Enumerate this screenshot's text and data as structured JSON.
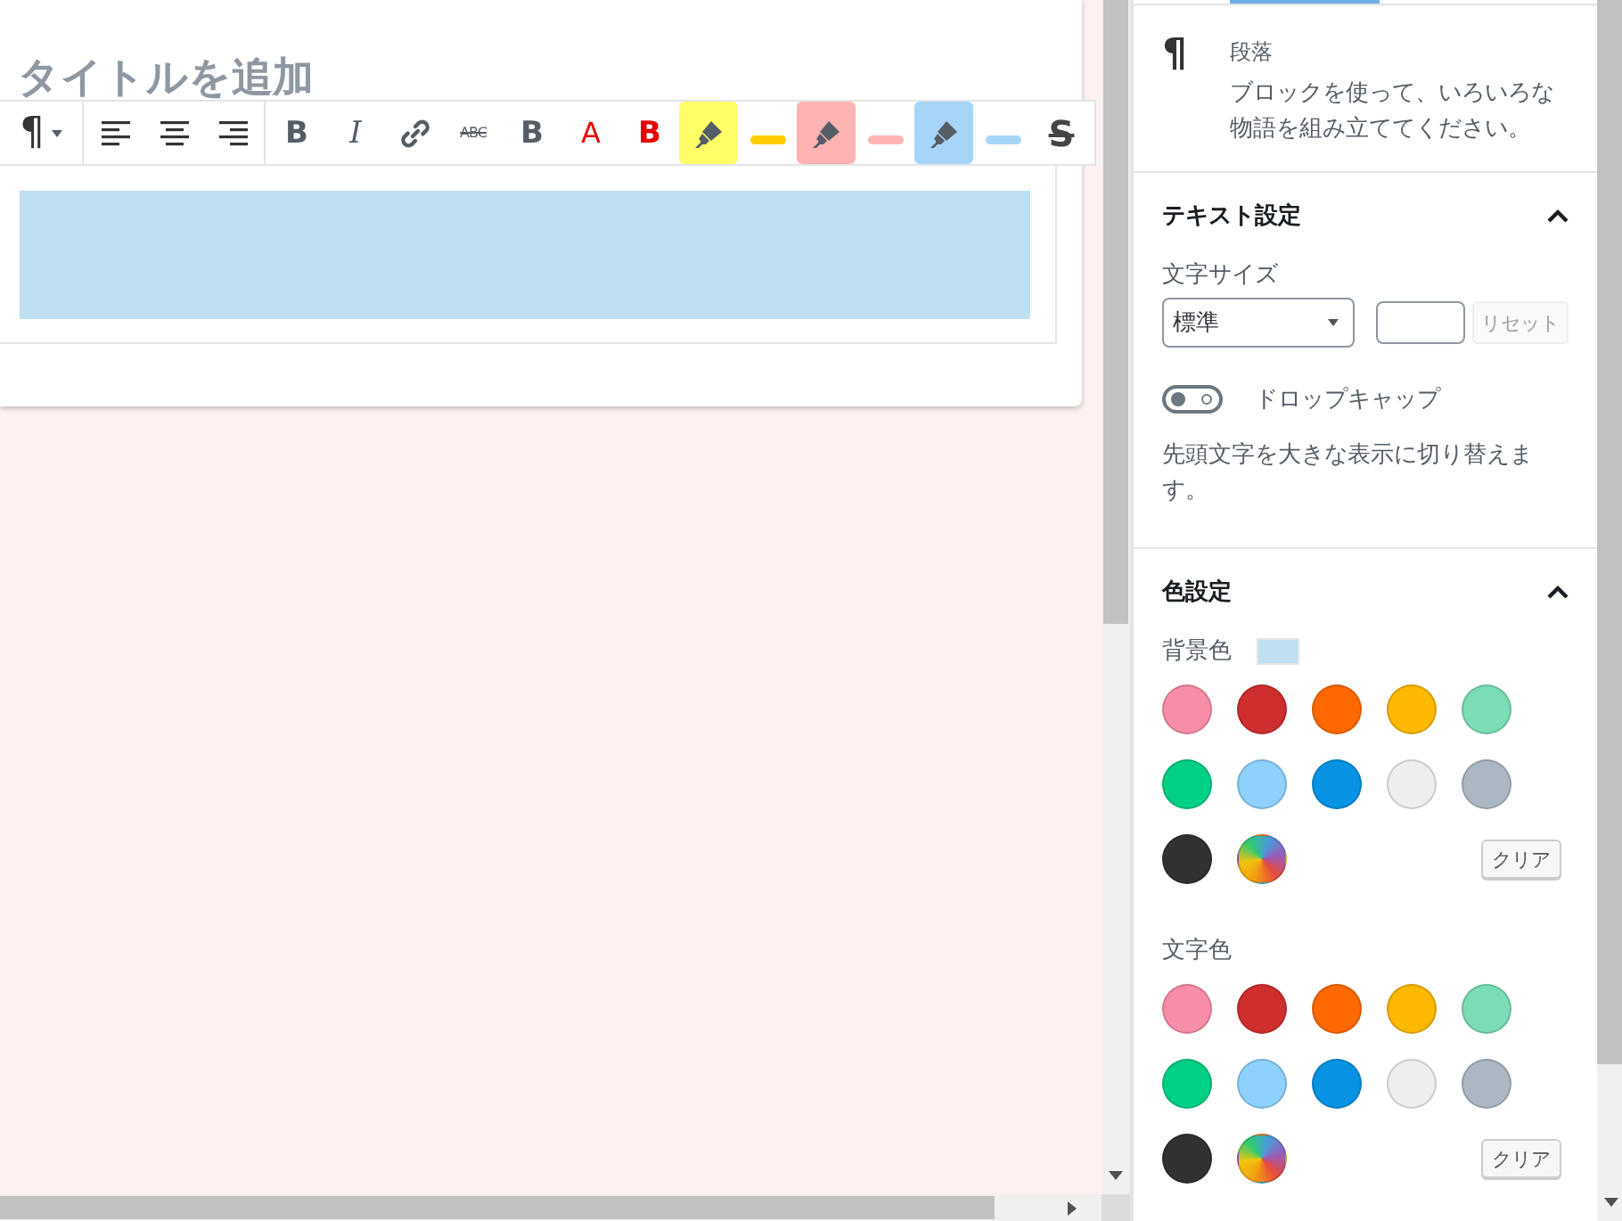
{
  "editor": {
    "title_placeholder": "タイトルを追加",
    "toolbar": {
      "groups": [
        {
          "items": [
            {
              "kind": "paragraph",
              "label": "¶"
            }
          ]
        },
        {
          "items": [
            {
              "kind": "align-left"
            },
            {
              "kind": "align-center"
            },
            {
              "kind": "align-right"
            }
          ]
        },
        {
          "items": [
            {
              "kind": "bold",
              "label": "B"
            },
            {
              "kind": "italic",
              "label": "I"
            },
            {
              "kind": "link"
            },
            {
              "kind": "strike-small",
              "label": "ABC"
            },
            {
              "kind": "bold",
              "label": "B"
            },
            {
              "kind": "letter",
              "label": "A",
              "color": "#e60000"
            },
            {
              "kind": "bold",
              "label": "B",
              "color": "#e60000"
            },
            {
              "kind": "marker",
              "color": "#ffff66"
            },
            {
              "kind": "line",
              "color": "#ffcc00"
            },
            {
              "kind": "marker",
              "color": "#ffb3b3"
            },
            {
              "kind": "line",
              "color": "#ffb3b3"
            },
            {
              "kind": "marker",
              "color": "#a6d5f7"
            },
            {
              "kind": "line",
              "color": "#a6d5f7"
            },
            {
              "kind": "strike",
              "label": "S"
            }
          ]
        }
      ]
    },
    "block": {
      "color": "#bee0f0"
    }
  },
  "sidebar": {
    "block_card": {
      "icon": "¶",
      "name": "段落",
      "description": "ブロックを使って、いろいろな物語を組み立ててください。"
    },
    "panels": [
      {
        "kind": "text-settings",
        "title": "テキスト設定",
        "expanded": true,
        "font_size": {
          "label": "文字サイズ",
          "select_value": "標準",
          "reset": {
            "label": "リセット",
            "disabled": true
          }
        },
        "drop_cap": {
          "label": "ドロップキャップ",
          "on": false,
          "help": "先頭文字を大きな表示に切り替えます。"
        }
      },
      {
        "kind": "color-settings",
        "title": "色設定",
        "expanded": true,
        "groups": [
          {
            "kind": "background",
            "label": "背景色",
            "clear": "クリア",
            "swatches": [
              {
                "kind": "solid",
                "color": "#f78da7"
              },
              {
                "kind": "solid",
                "color": "#cf2e2e"
              },
              {
                "kind": "solid",
                "color": "#ff6900"
              },
              {
                "kind": "solid",
                "color": "#fcb900"
              },
              {
                "kind": "solid",
                "color": "#7bdcb5"
              },
              {
                "kind": "solid",
                "color": "#00d084"
              },
              {
                "kind": "solid",
                "color": "#8ed1fc"
              },
              {
                "kind": "solid",
                "color": "#0693e3"
              },
              {
                "kind": "solid",
                "color": "#eeeeee"
              },
              {
                "kind": "solid",
                "color": "#abb8c3"
              },
              {
                "kind": "solid",
                "color": "#313131"
              },
              {
                "kind": "gradient"
              }
            ]
          },
          {
            "kind": "text",
            "label": "文字色",
            "clear": "クリア",
            "swatches": [
              {
                "kind": "solid",
                "color": "#f78da7"
              },
              {
                "kind": "solid",
                "color": "#cf2e2e"
              },
              {
                "kind": "solid",
                "color": "#ff6900"
              },
              {
                "kind": "solid",
                "color": "#fcb900"
              },
              {
                "kind": "solid",
                "color": "#7bdcb5"
              },
              {
                "kind": "solid",
                "color": "#00d084"
              },
              {
                "kind": "solid",
                "color": "#8ed1fc"
              },
              {
                "kind": "solid",
                "color": "#0693e3"
              },
              {
                "kind": "solid",
                "color": "#eeeeee"
              },
              {
                "kind": "solid",
                "color": "#abb8c3"
              },
              {
                "kind": "solid",
                "color": "#313131"
              },
              {
                "kind": "gradient"
              }
            ]
          }
        ]
      }
    ]
  }
}
